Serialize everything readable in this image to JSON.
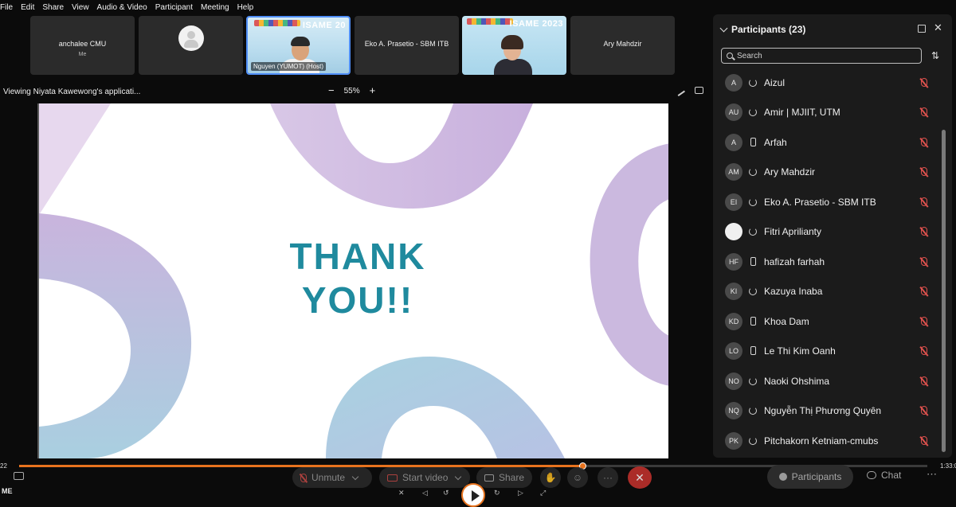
{
  "menu": [
    "File",
    "Edit",
    "Share",
    "View",
    "Audio & Video",
    "Participant",
    "Meeting",
    "Help"
  ],
  "videos": {
    "tile1": {
      "name": "anchalee CMU",
      "sub": "Me"
    },
    "tile3": {
      "label": "Nguyen (YUMOT) (Host)",
      "banner": "ISAME 20"
    },
    "tile4": {
      "name": "Eko A. Prasetio - SBM ITB"
    },
    "tile5": {
      "banner": "ISAME 2023"
    },
    "tile6": {
      "name": "Ary Mahdzir"
    }
  },
  "viewing": {
    "text": "Viewing Niyata Kawewong's applicati...",
    "zoom": "55%",
    "minus": "−",
    "plus": "+"
  },
  "slide": {
    "line1": "THANK",
    "line2": "YOU!!"
  },
  "colors": {
    "accent": "#e8731e",
    "slide_text": "#1f8a9e",
    "mute_red": "#e0524e",
    "end_red": "#c8322e"
  },
  "panel": {
    "title": "Participants (23)",
    "search_placeholder": "Search",
    "participants": [
      {
        "initials": "A",
        "name": "Aizul",
        "device": "sync"
      },
      {
        "initials": "AU",
        "name": "Amir | MJIIT, UTM",
        "device": "sync"
      },
      {
        "initials": "A",
        "name": "Arfah",
        "device": "phone"
      },
      {
        "initials": "AM",
        "name": "Ary Mahdzir",
        "device": "sync"
      },
      {
        "initials": "EI",
        "name": "Eko A. Prasetio - SBM ITB",
        "device": "sync"
      },
      {
        "initials": "",
        "name": "Fitri Aprilianty",
        "device": "sync",
        "photo": true
      },
      {
        "initials": "HF",
        "name": "hafizah farhah",
        "device": "phone"
      },
      {
        "initials": "KI",
        "name": "Kazuya Inaba",
        "device": "sync"
      },
      {
        "initials": "KD",
        "name": "Khoa Dam",
        "device": "phone"
      },
      {
        "initials": "LO",
        "name": "Le Thi Kim Oanh",
        "device": "phone"
      },
      {
        "initials": "NO",
        "name": "Naoki Ohshima",
        "device": "sync"
      },
      {
        "initials": "NQ",
        "name": "Nguyễn Thị Phương Quyên",
        "device": "sync"
      },
      {
        "initials": "PK",
        "name": "Pitchakorn Ketniam-cmubs",
        "device": "sync"
      }
    ]
  },
  "playback": {
    "time_left": "22",
    "time_right": "1:33:0",
    "progress": 0.62
  },
  "controls": {
    "unmute": "Unmute",
    "start_video": "Start video",
    "share": "Share",
    "participants": "Participants",
    "chat": "Chat",
    "more": "···",
    "me": "ME"
  }
}
